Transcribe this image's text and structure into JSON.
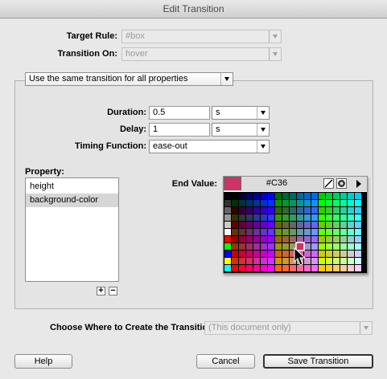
{
  "window": {
    "title": "Edit Transition"
  },
  "target_rule": {
    "label": "Target Rule:",
    "value": "#box"
  },
  "transition_on": {
    "label": "Transition On:",
    "value": "hover"
  },
  "mode_select": {
    "value": "Use the same transition for all properties"
  },
  "duration": {
    "label": "Duration:",
    "value": "0.5",
    "unit": "s"
  },
  "delay": {
    "label": "Delay:",
    "value": "1",
    "unit": "s"
  },
  "timing_function": {
    "label": "Timing Function:",
    "value": "ease-out"
  },
  "property": {
    "label": "Property:",
    "items": [
      "height",
      "background-color"
    ],
    "add_label": "+",
    "remove_label": "−"
  },
  "end_value": {
    "label": "End Value:",
    "hex": "#C36",
    "color": "#cc3366"
  },
  "create_where": {
    "label": "Choose Where to Create the Transition:",
    "value": "(This document only)"
  },
  "buttons": {
    "help": "Help",
    "cancel": "Cancel",
    "save": "Save Transition"
  },
  "icons": {
    "no_color": "slash-icon",
    "eyedropper": "color-wheel-icon",
    "menu": "right-arrow-icon"
  }
}
